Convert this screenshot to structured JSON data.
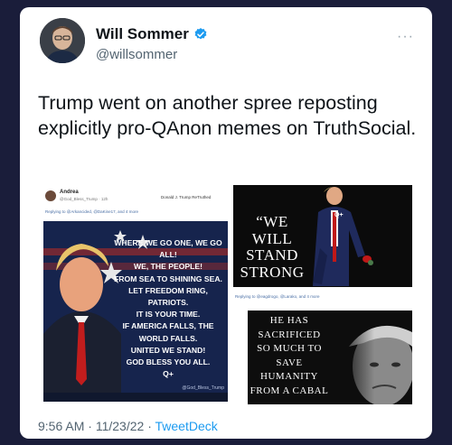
{
  "tweet": {
    "display_name": "Will Sommer",
    "handle": "@willsommer",
    "text": "Trump went on another spree reposting explicitly pro-QAnon memes on TruthSocial.",
    "time": "9:56 AM",
    "date": "11/23/22",
    "separator": "·",
    "source": "TweetDeck",
    "more_icon": "···"
  },
  "media": {
    "post": {
      "author": "Andrea",
      "author_handle": "@God_Bless_Trump · 12h",
      "retruth": "Donald J. Trump ReTruthed",
      "replying": "Replying to @Arkancided, @DaKine17, and 4 more",
      "meme_lines": [
        "WHERE WE GO ONE, WE GO ALL!",
        "WE, THE PEOPLE!",
        "FROM SEA TO SHINING SEA.",
        "LET FREEDOM RING, PATRIOTS.",
        "IT IS YOUR TIME.",
        "IF AMERICA FALLS, THE",
        "WORLD FALLS.",
        "UNITED WE STAND!",
        "GOD BLESS YOU ALL.",
        "Q+"
      ],
      "watermark": "@God_Bless_Trump"
    },
    "stand_strong": {
      "lines": [
        "“WE",
        "WILL",
        "STAND",
        "STRONG"
      ],
      "jacket_label": "Q+",
      "replying": "Replying to @eagdrogo, @Larako, and 4 more"
    },
    "sacrificed": {
      "lines": [
        "HE HAS",
        "SACRIFICED",
        "SO MUCH TO",
        "SAVE",
        "HUMANITY",
        "FROM A CABAL"
      ]
    }
  },
  "colors": {
    "background": "#1a1d3a",
    "card": "#ffffff",
    "text": "#0f1419",
    "muted": "#536471",
    "link": "#1d9bf0"
  }
}
